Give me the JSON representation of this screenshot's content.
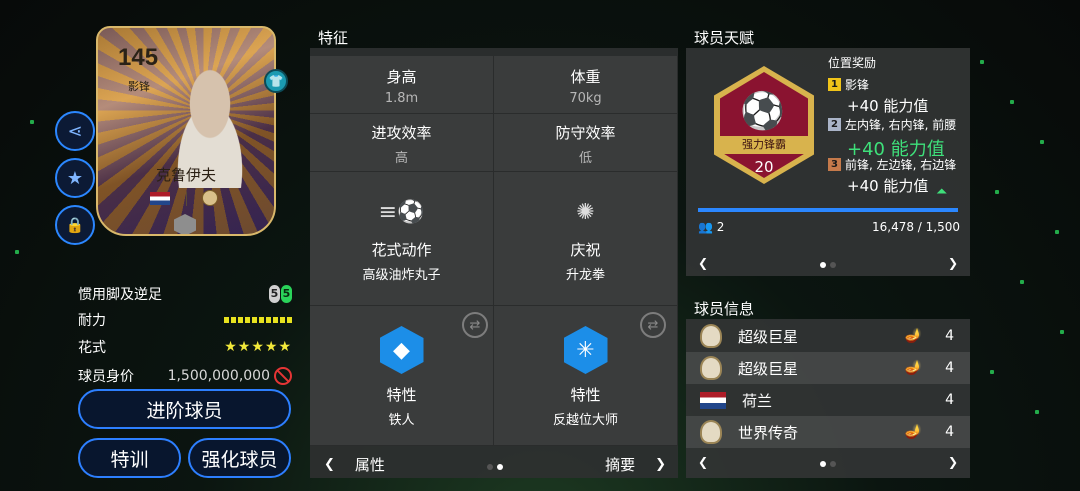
{
  "player_card": {
    "rating": "145",
    "position": "影锋",
    "name": "克鲁伊夫"
  },
  "player_stats": {
    "foot_label": "惯用脚及逆足",
    "foot_left": "5",
    "foot_right": "5",
    "stamina_label": "耐力",
    "stamina_level": 1.0,
    "skill_label": "花式",
    "skill_stars": "★★★★★",
    "value_label": "球员身价",
    "value": "1,500,000,000"
  },
  "buttons": {
    "advance": "进阶球员",
    "train": "特训",
    "enhance": "强化球员"
  },
  "traits_panel": {
    "title": "特征",
    "height_label": "身高",
    "height_value": "1.8m",
    "weight_label": "体重",
    "weight_value": "70kg",
    "att_label": "进攻效率",
    "att_value": "高",
    "def_label": "防守效率",
    "def_value": "低",
    "skill_move_label": "花式动作",
    "skill_move_value": "高级油炸丸子",
    "celebration_label": "庆祝",
    "celebration_value": "升龙拳",
    "trait1_label": "特性",
    "trait1_value": "铁人",
    "trait2_label": "特性",
    "trait2_value": "反越位大师",
    "pager_left": "属性",
    "pager_right": "摘要"
  },
  "talent_panel": {
    "title": "球员天赋",
    "badge_label": "强力锋霸",
    "badge_level": "20",
    "reward_header": "位置奖励",
    "rewards": [
      {
        "rank": "1",
        "positions": "影锋",
        "value": "+40 能力值",
        "color": "#f0c419"
      },
      {
        "rank": "2",
        "positions": "左内锋, 右内锋, 前腰",
        "value": "+40 能力值",
        "color": "#aab4c8"
      },
      {
        "rank": "3",
        "positions": "前锋, 左边锋, 右边锋",
        "value": "+40 能力值",
        "color": "#c57a4b"
      }
    ],
    "people_count": "2",
    "progress_text": "16,478 / 1,500",
    "progress_fraction": 1.0
  },
  "info_panel": {
    "title": "球员信息",
    "rows": [
      {
        "label": "超级巨星",
        "count": "4"
      },
      {
        "label": "超级巨星",
        "count": "4"
      },
      {
        "label": "荷兰",
        "count": "4"
      },
      {
        "label": "世界传奇",
        "count": "4"
      }
    ]
  },
  "icons": [
    "share-icon",
    "star-icon",
    "lock-icon",
    "jersey-icon",
    "ball-kick-icon",
    "fireworks-icon",
    "diamond-icon",
    "web-icon",
    "swap-icon",
    "lamp-icon",
    "ban-icon"
  ],
  "colors": {
    "accent_blue": "#2b87ff",
    "badge_red": "#8a1330",
    "badge_gold": "#d8b34d",
    "highlight_green": "#3ee07a",
    "stamina_yellow": "#e8e21f"
  }
}
